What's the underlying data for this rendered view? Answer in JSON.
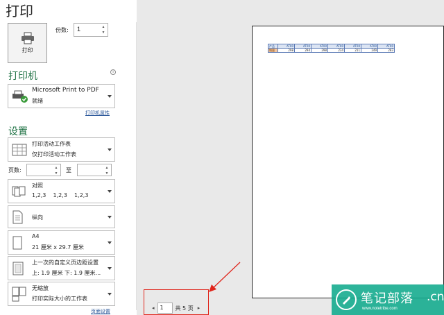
{
  "title": "打印",
  "print_button": {
    "label": "打印"
  },
  "copies": {
    "label": "份数:",
    "value": "1"
  },
  "printer": {
    "section": "打印机",
    "info": "i",
    "name": "Microsoft Print to PDF",
    "status": "就绪",
    "properties_link": "打印机属性"
  },
  "settings": {
    "section": "设置",
    "scope": {
      "line1": "打印活动工作表",
      "line2": "仅打印活动工作表"
    },
    "pages_label": "页数:",
    "to_label": "至",
    "collate": {
      "line1": "对照",
      "line2": "1,2,3    1,2,3    1,2,3"
    },
    "orientation": {
      "line1": "纵向"
    },
    "paper": {
      "line1": "A4",
      "line2": "21 厘米 x 29.7 厘米"
    },
    "margins": {
      "line1": "上一次的自定义页边距设置",
      "line2": "上: 1.9 厘米 下: 1.9 厘米..."
    },
    "scaling": {
      "line1": "无缩放",
      "line2": "打印实际大小的工作表"
    },
    "page_setup_link": "页面设置"
  },
  "preview": {
    "table_header": [
      "产品",
      "AT00",
      "AT00",
      "AT00",
      "AT00",
      "AT00",
      "AT00",
      "AT00"
    ],
    "table_row": [
      "销量",
      "298",
      "294",
      "298",
      "234",
      "211",
      "249",
      "283"
    ]
  },
  "navigation": {
    "prev": "◂",
    "current_page": "1",
    "total": "共 5 页",
    "next": "▸"
  },
  "watermark": {
    "title": "笔记部落",
    "url": "www.notetribe.com",
    "tail": ".cn"
  },
  "colors": {
    "accent": "#217346",
    "highlight_box": "#e0251b",
    "watermark_bg": "#10aa8c"
  }
}
